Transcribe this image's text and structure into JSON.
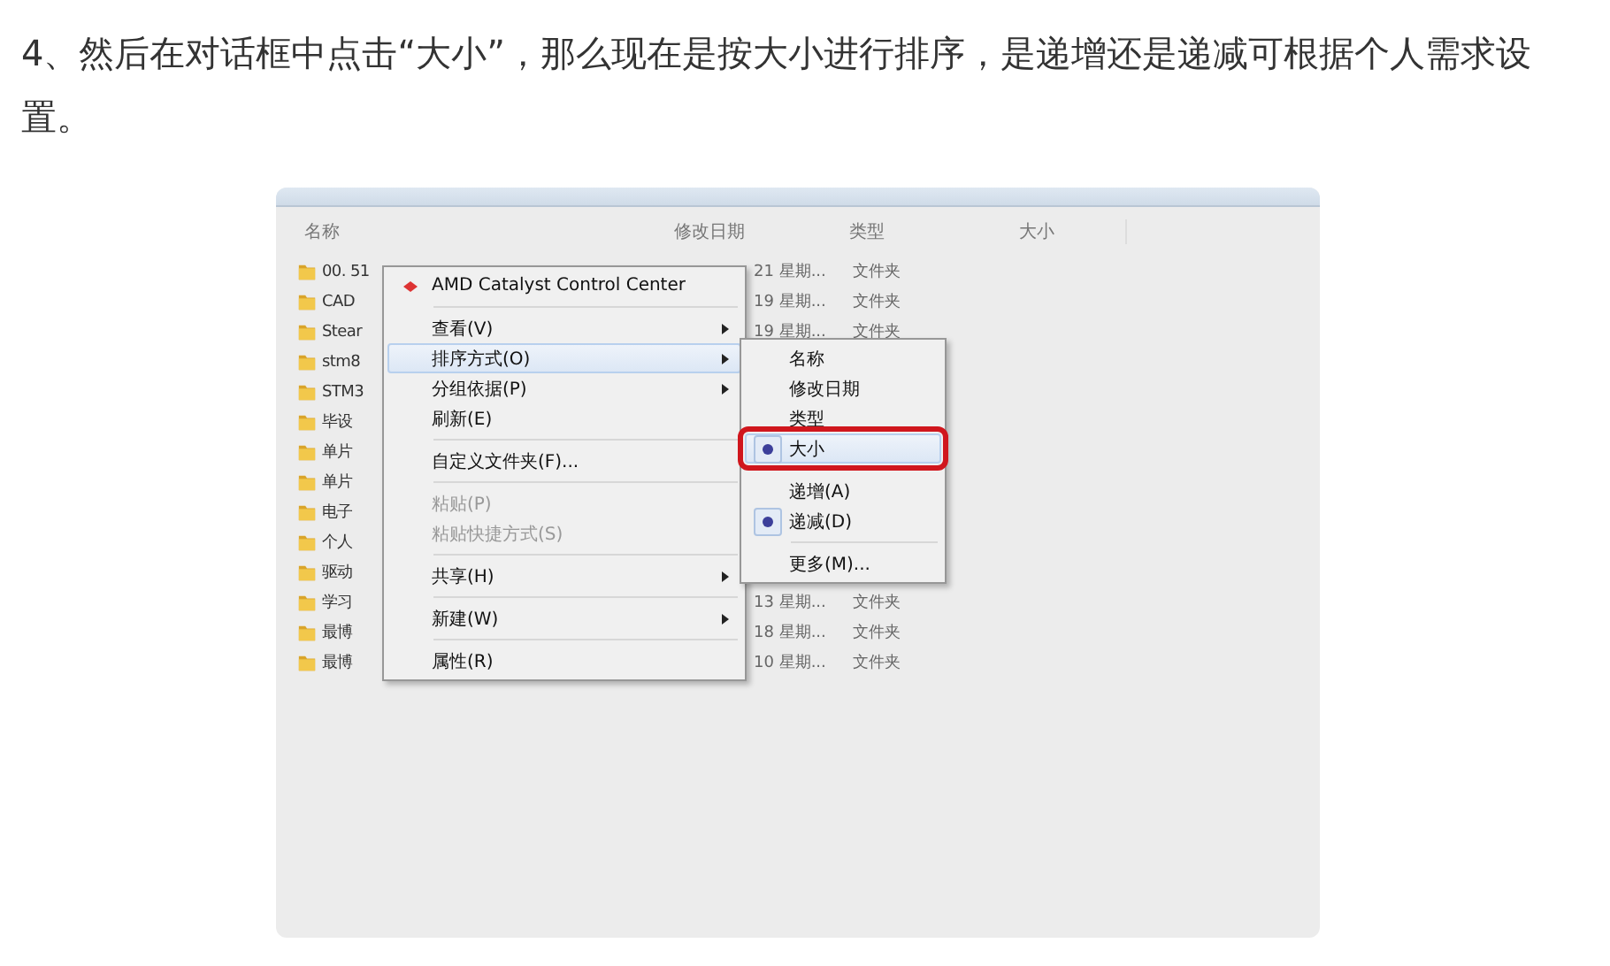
{
  "paragraph": "4、然后在对话框中点击“大小”，那么现在是按大小进行排序，是递增还是递减可根据个人需求设置。",
  "explorer": {
    "columns": [
      "名称",
      "修改日期",
      "类型",
      "大小"
    ],
    "rows": [
      {
        "name": "00. 51",
        "date": "21 星期...",
        "type": "文件夹"
      },
      {
        "name": "CAD",
        "date": "19 星期...",
        "type": "文件夹"
      },
      {
        "name": "Stear",
        "date": "19 星期...",
        "type": "文件夹"
      },
      {
        "name": "stm8"
      },
      {
        "name": "STM3"
      },
      {
        "name": "毕设"
      },
      {
        "name": "单片"
      },
      {
        "name": "单片"
      },
      {
        "name": "电子"
      },
      {
        "name": "个人"
      },
      {
        "name": "驱动"
      },
      {
        "name": "学习",
        "date": "13 星期...",
        "type": "文件夹"
      },
      {
        "name": "最博",
        "date": "18 星期...",
        "type": "文件夹"
      },
      {
        "name": "最博",
        "date": "10 星期...",
        "type": "文件夹"
      }
    ]
  },
  "context_menu": [
    {
      "kind": "app",
      "label": "AMD Catalyst Control Center",
      "disabled": false,
      "submenu": false,
      "selected": false
    },
    {
      "kind": "separator"
    },
    {
      "kind": "item",
      "label": "查看(V)",
      "disabled": false,
      "submenu": true,
      "selected": false
    },
    {
      "kind": "item",
      "label": "排序方式(O)",
      "disabled": false,
      "submenu": true,
      "selected": true
    },
    {
      "kind": "item",
      "label": "分组依据(P)",
      "disabled": false,
      "submenu": true,
      "selected": false
    },
    {
      "kind": "item",
      "label": "刷新(E)",
      "disabled": false,
      "submenu": false,
      "selected": false
    },
    {
      "kind": "separator"
    },
    {
      "kind": "item",
      "label": "自定义文件夹(F)...",
      "disabled": false,
      "submenu": false,
      "selected": false
    },
    {
      "kind": "separator"
    },
    {
      "kind": "item",
      "label": "粘贴(P)",
      "disabled": true,
      "submenu": false,
      "selected": false
    },
    {
      "kind": "item",
      "label": "粘贴快捷方式(S)",
      "disabled": true,
      "submenu": false,
      "selected": false
    },
    {
      "kind": "separator"
    },
    {
      "kind": "item",
      "label": "共享(H)",
      "disabled": false,
      "submenu": true,
      "selected": false
    },
    {
      "kind": "separator"
    },
    {
      "kind": "item",
      "label": "新建(W)",
      "disabled": false,
      "submenu": true,
      "selected": false
    },
    {
      "kind": "separator"
    },
    {
      "kind": "item",
      "label": "属性(R)",
      "disabled": false,
      "submenu": false,
      "selected": false
    }
  ],
  "sort_submenu": [
    {
      "kind": "item",
      "label": "名称",
      "checked": false,
      "selected": false,
      "outlined": false
    },
    {
      "kind": "item",
      "label": "修改日期",
      "checked": false,
      "selected": false,
      "outlined": false
    },
    {
      "kind": "item",
      "label": "类型",
      "checked": false,
      "selected": false,
      "outlined": false
    },
    {
      "kind": "item",
      "label": "大小",
      "checked": true,
      "selected": true,
      "outlined": true
    },
    {
      "kind": "separator"
    },
    {
      "kind": "item",
      "label": "递增(A)",
      "checked": false,
      "selected": false,
      "outlined": false
    },
    {
      "kind": "item",
      "label": "递减(D)",
      "checked": true,
      "selected": false,
      "outlined": false
    },
    {
      "kind": "separator"
    },
    {
      "kind": "item",
      "label": "更多(M)...",
      "checked": false,
      "selected": false,
      "outlined": false
    }
  ]
}
